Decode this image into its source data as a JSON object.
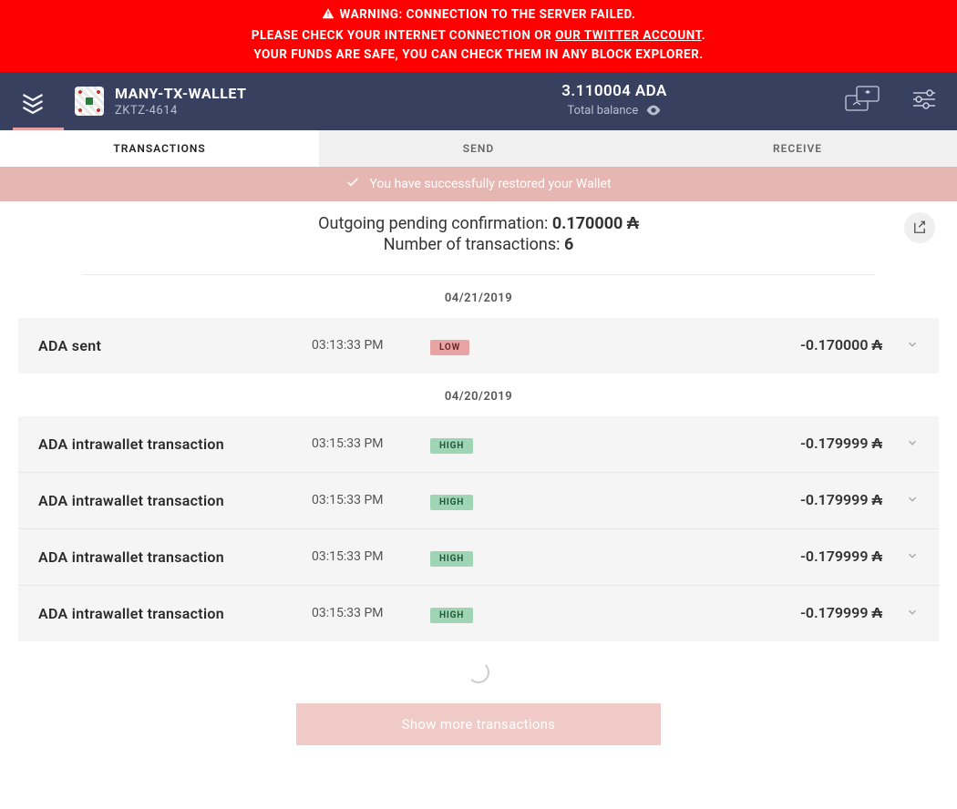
{
  "warning": {
    "line1": "WARNING: CONNECTION TO THE SERVER FAILED.",
    "line2_pre": "PLEASE CHECK YOUR INTERNET CONNECTION OR ",
    "line2_link": "OUR TWITTER ACCOUNT",
    "line2_post": ".",
    "line3": "YOUR FUNDS ARE SAFE, YOU CAN CHECK THEM IN ANY BLOCK EXPLORER."
  },
  "wallet": {
    "name": "MANY-TX-WALLET",
    "plate": "ZKTZ-4614",
    "balance_amount": "3.110004 ADA",
    "balance_label": "Total balance"
  },
  "tabs": {
    "transactions": "TRANSACTIONS",
    "send": "SEND",
    "receive": "RECEIVE"
  },
  "notice": {
    "text": "You have successfully restored your Wallet"
  },
  "summary": {
    "pending_label": "Outgoing pending confirmation: ",
    "pending_value": "0.170000 ₳",
    "count_label": "Number of transactions: ",
    "count_value": "6"
  },
  "groups": [
    {
      "date": "04/21/2019",
      "rows": [
        {
          "type": "ADA sent",
          "time": "03:13:33 PM",
          "badge": "LOW",
          "badge_class": "low",
          "amount": "-0.170000 ₳"
        }
      ]
    },
    {
      "date": "04/20/2019",
      "rows": [
        {
          "type": "ADA intrawallet transaction",
          "time": "03:15:33 PM",
          "badge": "HIGH",
          "badge_class": "high",
          "amount": "-0.179999 ₳"
        },
        {
          "type": "ADA intrawallet transaction",
          "time": "03:15:33 PM",
          "badge": "HIGH",
          "badge_class": "high",
          "amount": "-0.179999 ₳"
        },
        {
          "type": "ADA intrawallet transaction",
          "time": "03:15:33 PM",
          "badge": "HIGH",
          "badge_class": "high",
          "amount": "-0.179999 ₳"
        },
        {
          "type": "ADA intrawallet transaction",
          "time": "03:15:33 PM",
          "badge": "HIGH",
          "badge_class": "high",
          "amount": "-0.179999 ₳"
        }
      ]
    }
  ],
  "actions": {
    "show_more": "Show more transactions"
  }
}
